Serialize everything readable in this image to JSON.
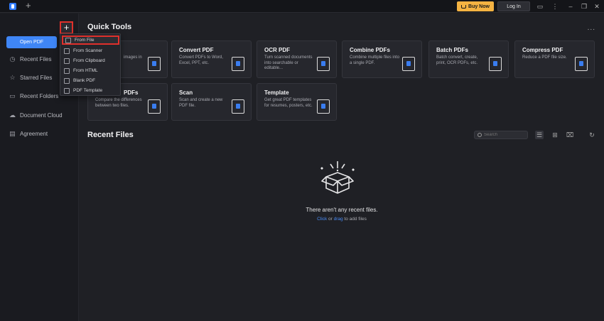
{
  "titlebar": {
    "new_tab": "+",
    "buy_now": "Buy Now",
    "log_in": "Log In",
    "icons": [
      "chat-icon",
      "more-vertical-icon",
      "minimize-icon",
      "restore-icon",
      "close-icon"
    ]
  },
  "sidebar": {
    "open_pdf": "Open PDF",
    "plus": "+",
    "items": [
      {
        "label": "Recent Files",
        "icon": "clock-icon"
      },
      {
        "label": "Starred Files",
        "icon": "star-icon"
      },
      {
        "label": "Recent Folders",
        "icon": "folder-icon"
      },
      {
        "label": "Document Cloud",
        "icon": "cloud-icon"
      },
      {
        "label": "Agreement",
        "icon": "document-icon"
      }
    ]
  },
  "dropdown": {
    "items": [
      {
        "label": "From File",
        "icon": "folder-icon"
      },
      {
        "label": "From Scanner",
        "icon": "scanner-icon"
      },
      {
        "label": "From Clipboard",
        "icon": "clipboard-icon"
      },
      {
        "label": "From HTML",
        "icon": "html-icon"
      },
      {
        "label": "Blank PDF",
        "icon": "blank-page-icon"
      },
      {
        "label": "PDF Template",
        "icon": "template-icon"
      }
    ]
  },
  "quick_tools": {
    "title": "Quick Tools",
    "more": "...",
    "cards": [
      {
        "title": "",
        "desc": "images in",
        "icon": "edit-pdf-icon"
      },
      {
        "title": "Convert PDF",
        "desc": "Convert PDFs to Word, Excel, PPT, etc.",
        "icon": "convert-pdf-icon"
      },
      {
        "title": "OCR PDF",
        "desc": "Turn scanned documents into searchable or editable...",
        "icon": "ocr-pdf-icon"
      },
      {
        "title": "Combine PDFs",
        "desc": "Combine multiple files into a single PDF.",
        "icon": "combine-pdfs-icon"
      },
      {
        "title": "Batch PDFs",
        "desc": "Batch convert, create, print, OCR PDFs, etc.",
        "icon": "batch-pdfs-icon"
      },
      {
        "title": "Compress PDF",
        "desc": "Reduce a PDF file size.",
        "icon": "compress-pdf-icon"
      },
      {
        "title": "PDFs",
        "desc": "Compare the differences between two files.",
        "icon": "compare-pdfs-icon"
      },
      {
        "title": "Scan",
        "desc": "Scan and create a new PDF file.",
        "icon": "scan-icon"
      },
      {
        "title": "Template",
        "desc": "Get great PDF templates for resumes, posters, etc.",
        "icon": "template-icon"
      }
    ]
  },
  "recent_files": {
    "title": "Recent Files",
    "search_placeholder": "Search",
    "empty_text": "There aren't any recent files.",
    "empty_sub_click": "Click",
    "empty_sub_or": " or ",
    "empty_sub_drag": "drag",
    "empty_sub_rest": " to add files"
  }
}
